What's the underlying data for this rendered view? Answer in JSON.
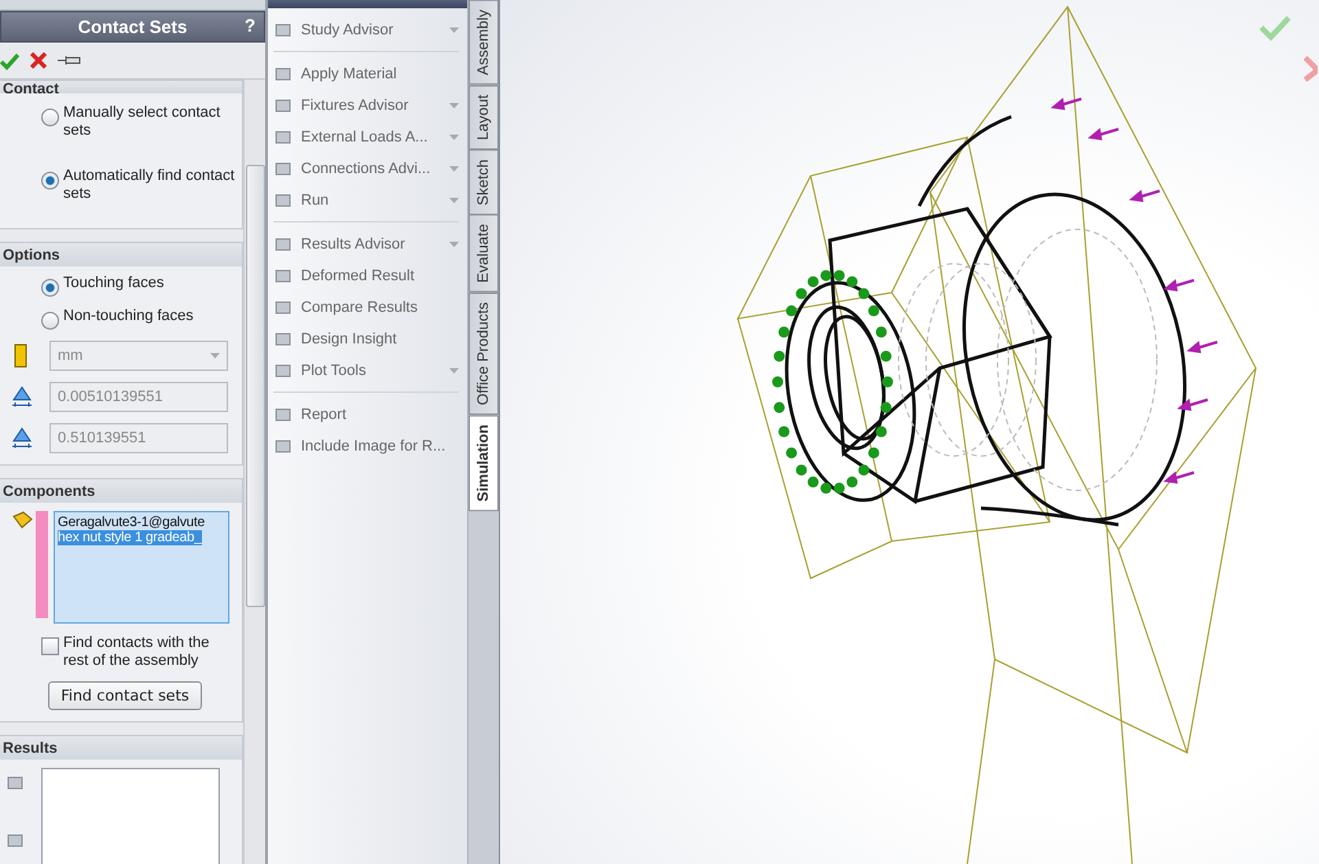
{
  "property_manager": {
    "title": "Contact Sets",
    "help": "?",
    "contact": {
      "title": "Contact",
      "options": [
        {
          "label": "Manually select contact sets",
          "selected": false
        },
        {
          "label": "Automatically find contact sets",
          "selected": true
        }
      ]
    },
    "options": {
      "title": "Options",
      "options": [
        {
          "label": "Touching faces",
          "selected": true
        },
        {
          "label": "Non-touching faces",
          "selected": false
        }
      ],
      "unit": "mm",
      "fields": [
        "0.00510139551",
        "0.510139551"
      ]
    },
    "components": {
      "title": "Components",
      "items": [
        {
          "label": "Geragalvute3-1@galvute",
          "selected": false
        },
        {
          "label": "hex nut style 1 gradeab_",
          "selected": true
        }
      ],
      "checkbox": {
        "label": "Find contacts with the rest of the assembly",
        "checked": false
      },
      "button": "Find contact sets"
    },
    "results": {
      "title": "Results"
    }
  },
  "command_manager": {
    "groups": [
      [
        {
          "label": "Study Advisor",
          "dropdown": true
        }
      ],
      [
        {
          "label": "Apply Material",
          "dropdown": false
        },
        {
          "label": "Fixtures Advisor",
          "dropdown": true
        },
        {
          "label": "External Loads A...",
          "dropdown": true
        },
        {
          "label": "Connections Advi...",
          "dropdown": true
        },
        {
          "label": "Run",
          "dropdown": true
        }
      ],
      [
        {
          "label": "Results Advisor",
          "dropdown": true
        },
        {
          "label": "Deformed Result",
          "dropdown": false
        },
        {
          "label": "Compare Results",
          "dropdown": false
        },
        {
          "label": "Design Insight",
          "dropdown": false
        },
        {
          "label": "Plot Tools",
          "dropdown": true
        }
      ],
      [
        {
          "label": "Report",
          "dropdown": false
        },
        {
          "label": "Include Image for R...",
          "dropdown": false
        }
      ]
    ],
    "tabs": [
      {
        "label": "Assembly",
        "selected": false
      },
      {
        "label": "Layout",
        "selected": false
      },
      {
        "label": "Sketch",
        "selected": false
      },
      {
        "label": "Evaluate",
        "selected": false
      },
      {
        "label": "Office Products",
        "selected": false
      },
      {
        "label": "Simulation",
        "selected": true
      }
    ]
  }
}
